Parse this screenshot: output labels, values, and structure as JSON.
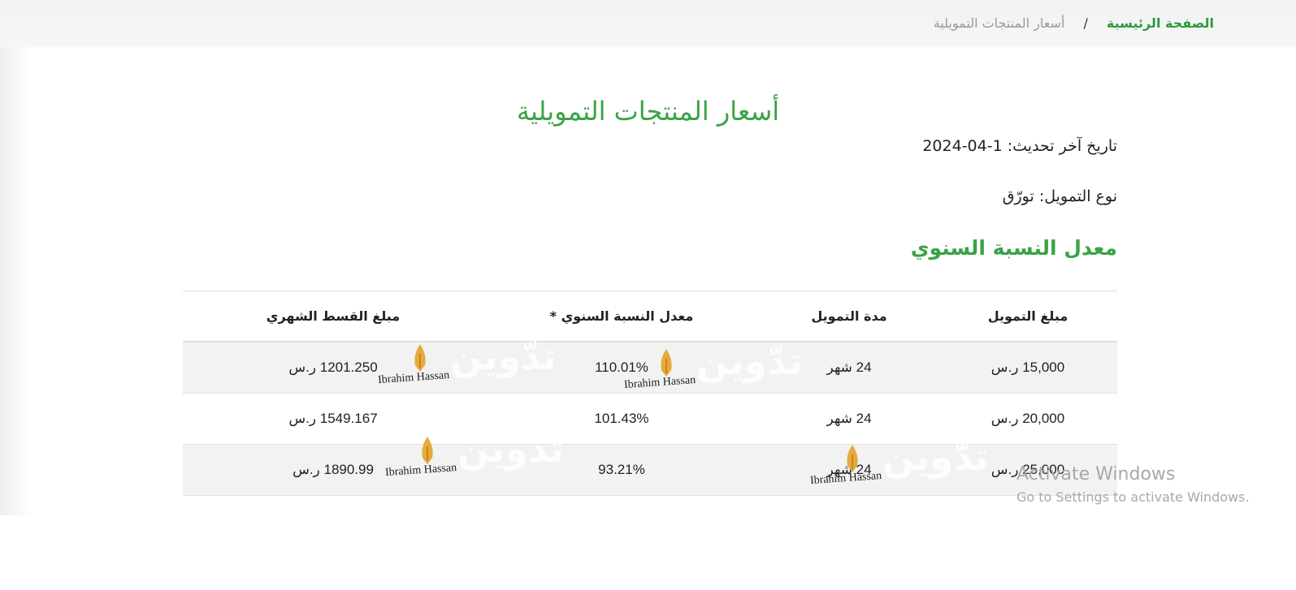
{
  "breadcrumb": {
    "home": "الصفحة الرئيسية",
    "separator": "/",
    "current": "أسعار المنتجات التمويلية"
  },
  "page_title": "أسعار المنتجات التمويلية",
  "info": {
    "last_update": "تاريخ آخر تحديث: 1-04-2024",
    "financing_type": "نوع التمويل: تورّق"
  },
  "section_title": "معدل النسبة السنوي",
  "table": {
    "headers": [
      "مبلغ التمويل",
      "مدة التمويل",
      "معدل النسبة السنوي *",
      "مبلغ القسط الشهري"
    ],
    "rows": [
      [
        "15,000 ر.س",
        "24 شهر",
        "110.01%",
        "1201.250 ر.س"
      ],
      [
        "20,000 ر.س",
        "24 شهر",
        "101.43%",
        "1549.167 ر.س"
      ],
      [
        "25,000 ر.س",
        "24 شهر",
        "93.21%",
        "1890.99 ر.س"
      ]
    ]
  },
  "watermark": {
    "text": "تدّوين",
    "name": "Ibrahim Hassan",
    "icon": "pen-nib-icon"
  },
  "os_notice": {
    "title": "Activate Windows",
    "subtitle": "Go to Settings to activate Windows."
  },
  "colors": {
    "accent": "#3aa346",
    "link": "#2d9a3e",
    "muted": "#9a9a9a",
    "stripe": "#f2f2f2",
    "pen": "#e8a93a"
  }
}
